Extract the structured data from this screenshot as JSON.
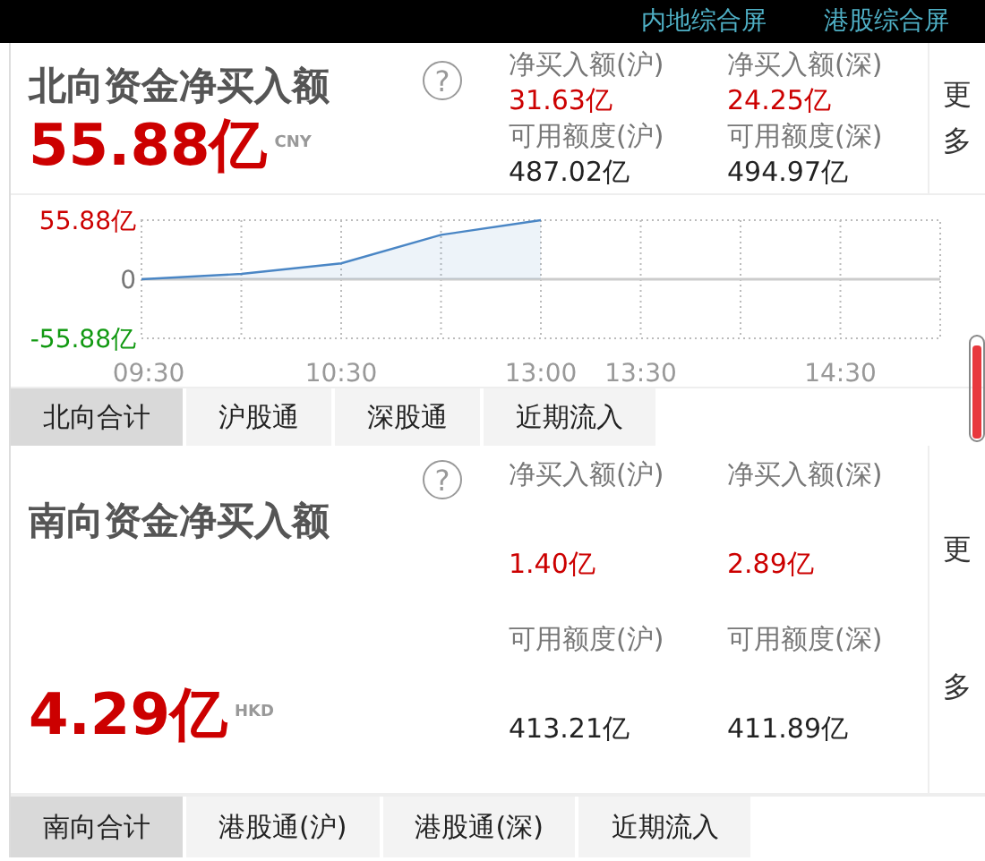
{
  "top_links": [
    {
      "label": "内地综合屏"
    },
    {
      "label": "港股综合屏"
    }
  ],
  "panels": [
    {
      "title": "北向资金净买入额",
      "help_icon": "?",
      "total": "55.88亿",
      "currency": "CNY",
      "more": "更多",
      "stats": [
        {
          "label": "净买入额(沪)",
          "value": "31.63亿",
          "kind": "flow"
        },
        {
          "label": "净买入额(深)",
          "value": "24.25亿",
          "kind": "flow"
        },
        {
          "label": "可用额度(沪)",
          "value": "487.02亿",
          "kind": "quota"
        },
        {
          "label": "可用额度(深)",
          "value": "494.97亿",
          "kind": "quota"
        }
      ],
      "chart_data": {
        "type": "area",
        "categories": [
          "09:30",
          null,
          "10:30",
          null,
          "13:00",
          "13:30",
          null,
          "14:30",
          null
        ],
        "series": [
          {
            "color": "#4a86c5",
            "values": [
              0,
              5,
              15,
              42,
              55.88,
              null,
              null,
              null,
              null
            ]
          }
        ],
        "ylim": [
          -55.88,
          55.88
        ],
        "grid": true,
        "yticks": [
          {
            "value": 55.88,
            "label": "55.88亿"
          },
          {
            "value": 0,
            "label": "0"
          },
          {
            "value": -55.88,
            "label": "-55.88亿"
          }
        ]
      },
      "tabs": [
        {
          "label": "北向合计",
          "selected": true
        },
        {
          "label": "沪股通",
          "selected": false
        },
        {
          "label": "深股通",
          "selected": false
        },
        {
          "label": "近期流入",
          "selected": false
        }
      ]
    },
    {
      "title": "南向资金净买入额",
      "help_icon": "?",
      "total": "4.29亿",
      "currency": "HKD",
      "more": "更多",
      "stats": [
        {
          "label": "净买入额(沪)",
          "value": "1.40亿",
          "kind": "flow"
        },
        {
          "label": "净买入额(深)",
          "value": "2.89亿",
          "kind": "flow"
        },
        {
          "label": "可用额度(沪)",
          "value": "413.21亿",
          "kind": "quota"
        },
        {
          "label": "可用额度(深)",
          "value": "411.89亿",
          "kind": "quota"
        }
      ],
      "tabs": [
        {
          "label": "南向合计",
          "selected": true
        },
        {
          "label": "港股通(沪)",
          "selected": false
        },
        {
          "label": "港股通(深)",
          "selected": false
        },
        {
          "label": "近期流入",
          "selected": false
        }
      ]
    }
  ]
}
